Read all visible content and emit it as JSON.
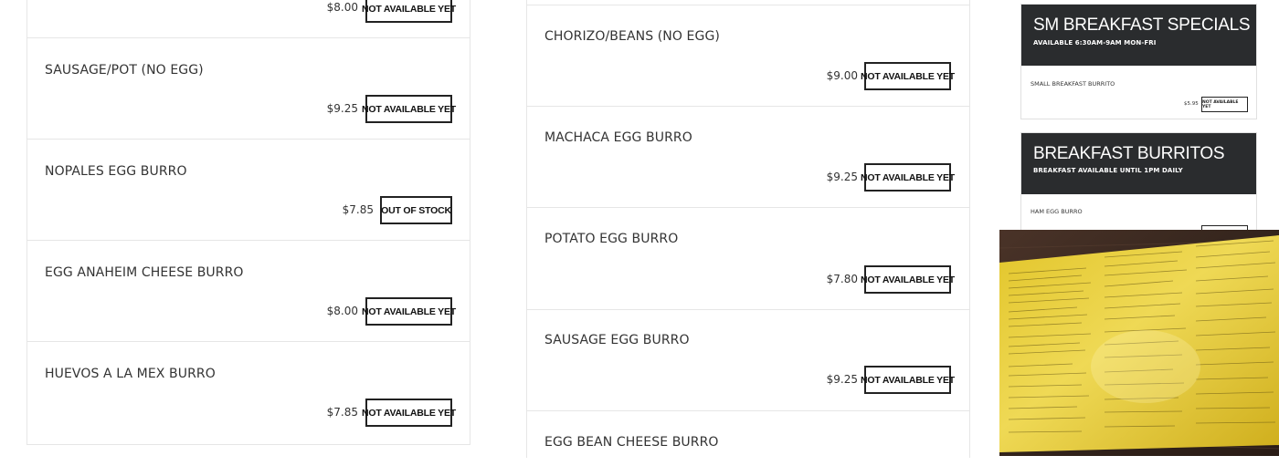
{
  "left_column": {
    "top_partial": {
      "price": "$8.00",
      "button": "NOT AVAILABLE YET"
    },
    "items": [
      {
        "name": "SAUSAGE/POT (NO EGG)",
        "price": "$9.25",
        "button": "NOT AVAILABLE YET"
      },
      {
        "name": "NOPALES EGG BURRO",
        "price": "$7.85",
        "button": "OUT OF STOCK"
      },
      {
        "name": "EGG ANAHEIM CHEESE BURRO",
        "price": "$8.00",
        "button": "NOT AVAILABLE YET"
      },
      {
        "name": "HUEVOS A LA MEX BURRO",
        "price": "$7.85",
        "button": "NOT AVAILABLE YET"
      }
    ]
  },
  "middle_column": {
    "items": [
      {
        "name": "CHORIZO/BEANS (NO EGG)",
        "price": "$9.00",
        "button": "NOT AVAILABLE YET"
      },
      {
        "name": "MACHACA EGG BURRO",
        "price": "$9.25",
        "button": "NOT AVAILABLE YET"
      },
      {
        "name": "POTATO EGG BURRO",
        "price": "$7.80",
        "button": "NOT AVAILABLE YET"
      },
      {
        "name": "SAUSAGE EGG BURRO",
        "price": "$9.25",
        "button": "NOT AVAILABLE YET"
      },
      {
        "name": "EGG BEAN CHEESE BURRO"
      }
    ]
  },
  "side_sections": [
    {
      "title": "SM BREAKFAST SPECIALS",
      "subtitle": "AVAILABLE 6:30AM-9AM MON-FRI",
      "item": "SMALL BREAKFAST BURRITO",
      "price": "$5.95",
      "button": "NOT AVAILABLE YET"
    },
    {
      "title": "BREAKFAST BURRITOS",
      "subtitle": "BREAKFAST AVAILABLE UNTIL 1PM DAILY",
      "item": "HAM EGG BURRO"
    }
  ],
  "colors": {
    "header_bg": "#2a2c2e",
    "border": "#e6e6e6",
    "menu_yellow": "#e3c624",
    "wood": "#3d2a22"
  }
}
